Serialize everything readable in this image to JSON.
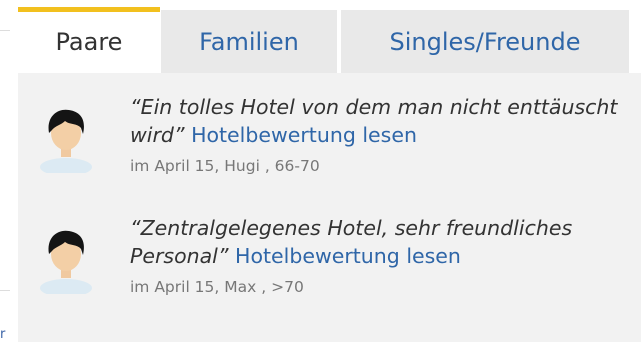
{
  "tabs": [
    {
      "label": "Paare",
      "active": true
    },
    {
      "label": "Familien",
      "active": false
    },
    {
      "label": "Singles/Freunde",
      "active": false
    }
  ],
  "reviews": [
    {
      "quote": "“Ein tolles Hotel von dem man nicht enttäuscht wird”",
      "link_label": "Hotelbewertung lesen",
      "meta": "im April 15, Hugi , 66-70",
      "avatar_icon": "user-avatar-icon"
    },
    {
      "quote": "“Zentralgelegenes Hotel, sehr freundliches Personal”",
      "link_label": "Hotelbewertung lesen",
      "meta": "im April 15, Max , >70",
      "avatar_icon": "user-avatar-icon"
    }
  ],
  "colors": {
    "tab_active_border": "#f2c01e",
    "tab_inactive_bg": "#e9e9e9",
    "panel_bg": "#f2f2f2",
    "link": "#2f66a8",
    "meta_text": "#777777"
  },
  "edge_glyph": "r"
}
